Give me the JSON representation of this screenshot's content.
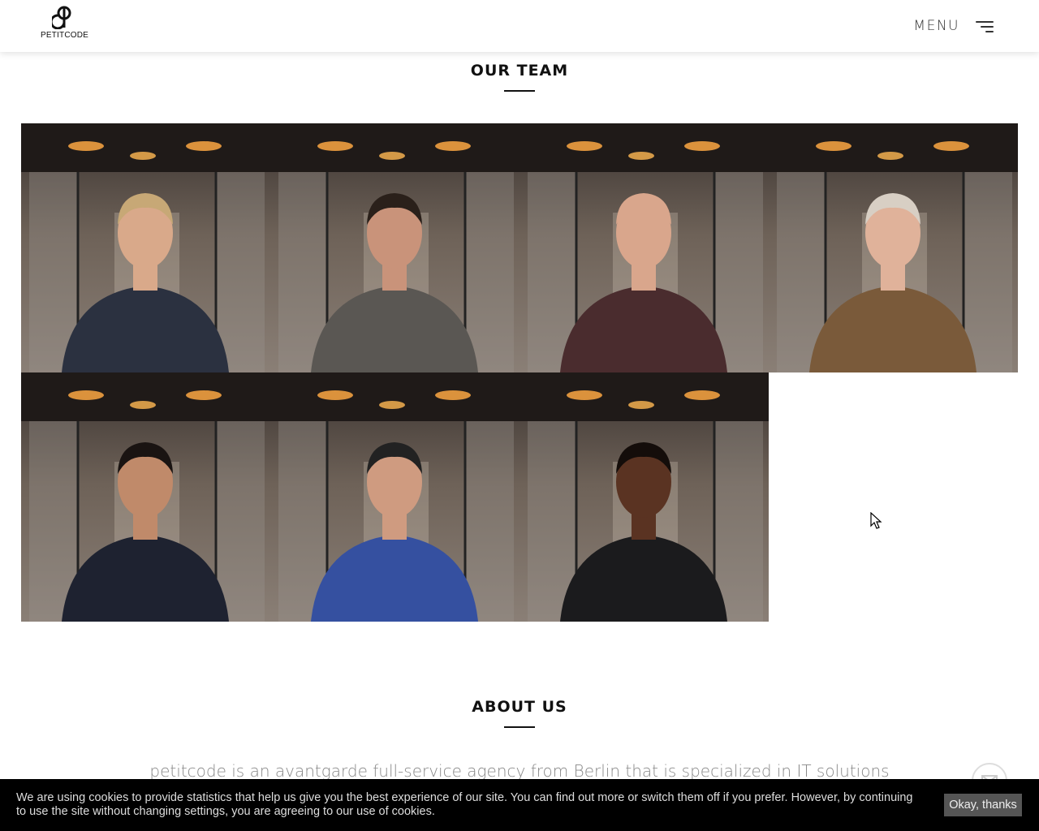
{
  "header": {
    "logo_text": "PETITCODE",
    "menu_label": "MENU",
    "logo_icon": "petitcode-logo-icon",
    "menu_icon": "hamburger-icon"
  },
  "team": {
    "title": "OUR TEAM",
    "members": [
      {
        "name": "team-member-1",
        "shirt": "#2b3140",
        "skin": "#d9a98a",
        "hair": "#c7a876"
      },
      {
        "name": "team-member-2",
        "shirt": "#5a5753",
        "skin": "#c9937a",
        "hair": "#2a201a"
      },
      {
        "name": "team-member-3",
        "shirt": "#4a2c2e",
        "skin": "#d9a68c",
        "hair": "#d9a68c"
      },
      {
        "name": "team-member-4",
        "shirt": "#7a5a3a",
        "skin": "#e0b29a",
        "hair": "#d8cfc4"
      },
      {
        "name": "team-member-5",
        "shirt": "#1e2230",
        "skin": "#c08a6a",
        "hair": "#1a1412"
      },
      {
        "name": "team-member-6",
        "shirt": "#3550a0",
        "skin": "#cf9b80",
        "hair": "#222"
      },
      {
        "name": "team-member-7",
        "shirt": "#1b1b1d",
        "skin": "#5a3322",
        "hair": "#140d0a"
      }
    ]
  },
  "about": {
    "title": "ABOUT US",
    "text": "petitcode is an avantgarde full-service agency from Berlin that is specialized in IT solutions"
  },
  "cookie": {
    "text": "We are using cookies to provide statistics that help us give you the best experience of our site. You can find out more or switch them off if you prefer. However, by continuing to use the site without changing settings, you are agreeing to our use of cookies.",
    "button": "Okay, thanks"
  },
  "colors": {
    "accent": "#111111",
    "cookie_bg": "#000000",
    "cookie_button_bg": "#555555"
  }
}
